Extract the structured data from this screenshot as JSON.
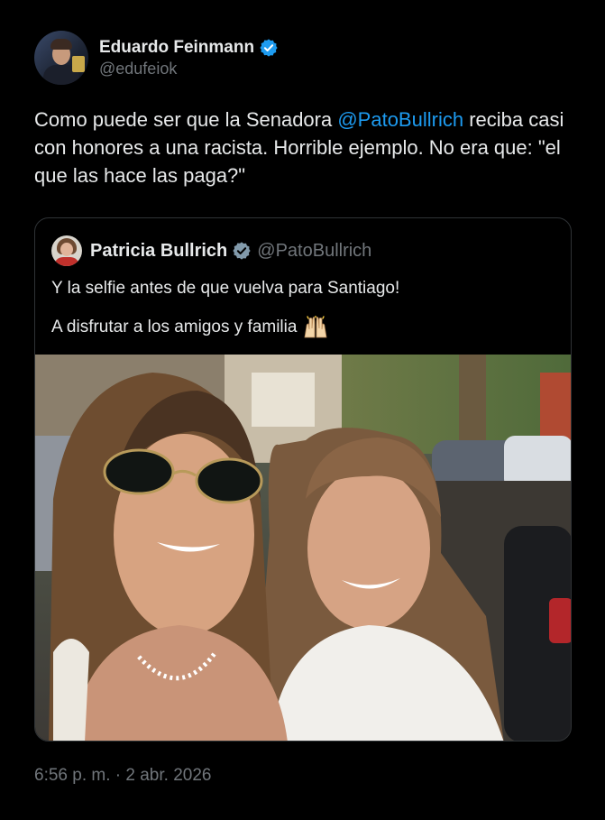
{
  "author": {
    "name": "Eduardo Feinmann",
    "handle": "@edufeiok",
    "verified": true
  },
  "tweet": {
    "text_before": "Como puede ser que la Senadora ",
    "mention": "@PatoBullrich",
    "text_after": " reciba casi con honores a una racista. Horrible ejemplo. No era que: \"el que las hace las paga?\""
  },
  "quoted": {
    "name": "Patricia Bullrich",
    "handle": "@PatoBullrich",
    "verified": true,
    "line1": "Y la selfie antes de que vuelva para Santiago!",
    "line2": "A disfrutar a los amigos y familia",
    "emoji": "raising-hands"
  },
  "timestamp": "6:56 p. m. · 2 abr. 2026",
  "colors": {
    "background": "#000000",
    "text": "#e7e9ea",
    "secondary": "#71767b",
    "accent": "#1d9bf0",
    "border": "#2f3336"
  }
}
